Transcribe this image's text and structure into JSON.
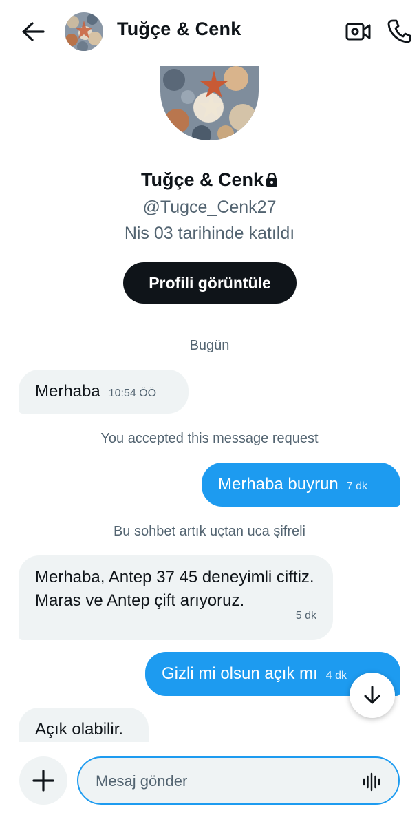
{
  "header": {
    "title": "Tuğçe & Cenk",
    "back_icon": "arrow-left-icon",
    "video_icon": "video-camera-icon",
    "call_icon": "phone-icon"
  },
  "profile": {
    "name": "Tuğçe & Cenk",
    "handle": "@Tugce_Cenk27",
    "joined": "Nis 03 tarihinde katıldı",
    "view_button": "Profili görüntüle",
    "lock_icon": "lock-icon"
  },
  "chat": {
    "date_divider": "Bugün",
    "accepted_notice": "You accepted this message request",
    "encryption_notice": "Bu sohbet artık uçtan uca şifreli",
    "messages": [
      {
        "direction": "in",
        "text": "Merhaba",
        "time": "10:54 ÖÖ"
      },
      {
        "direction": "out",
        "text": "Merhaba buyrun",
        "time": "7 dk"
      },
      {
        "direction": "in",
        "text": "Merhaba, Antep 37 45 deneyimli ciftiz. Maras ve Antep çift arıyoruz.",
        "time": "5 dk"
      },
      {
        "direction": "out",
        "text": "Gizli mi olsun açık mı",
        "time": "4 dk"
      },
      {
        "direction": "in",
        "text": "Açık olabilir.",
        "time": ""
      }
    ]
  },
  "composer": {
    "placeholder": "Mesaj gönder",
    "plus_icon": "plus-icon",
    "voice_icon": "voice-waveform-icon"
  },
  "colors": {
    "accent": "#1d9bf0",
    "bubble_in": "#eff3f4",
    "text_primary": "#0f1419",
    "text_secondary": "#536471",
    "button_dark": "#0f1419"
  }
}
